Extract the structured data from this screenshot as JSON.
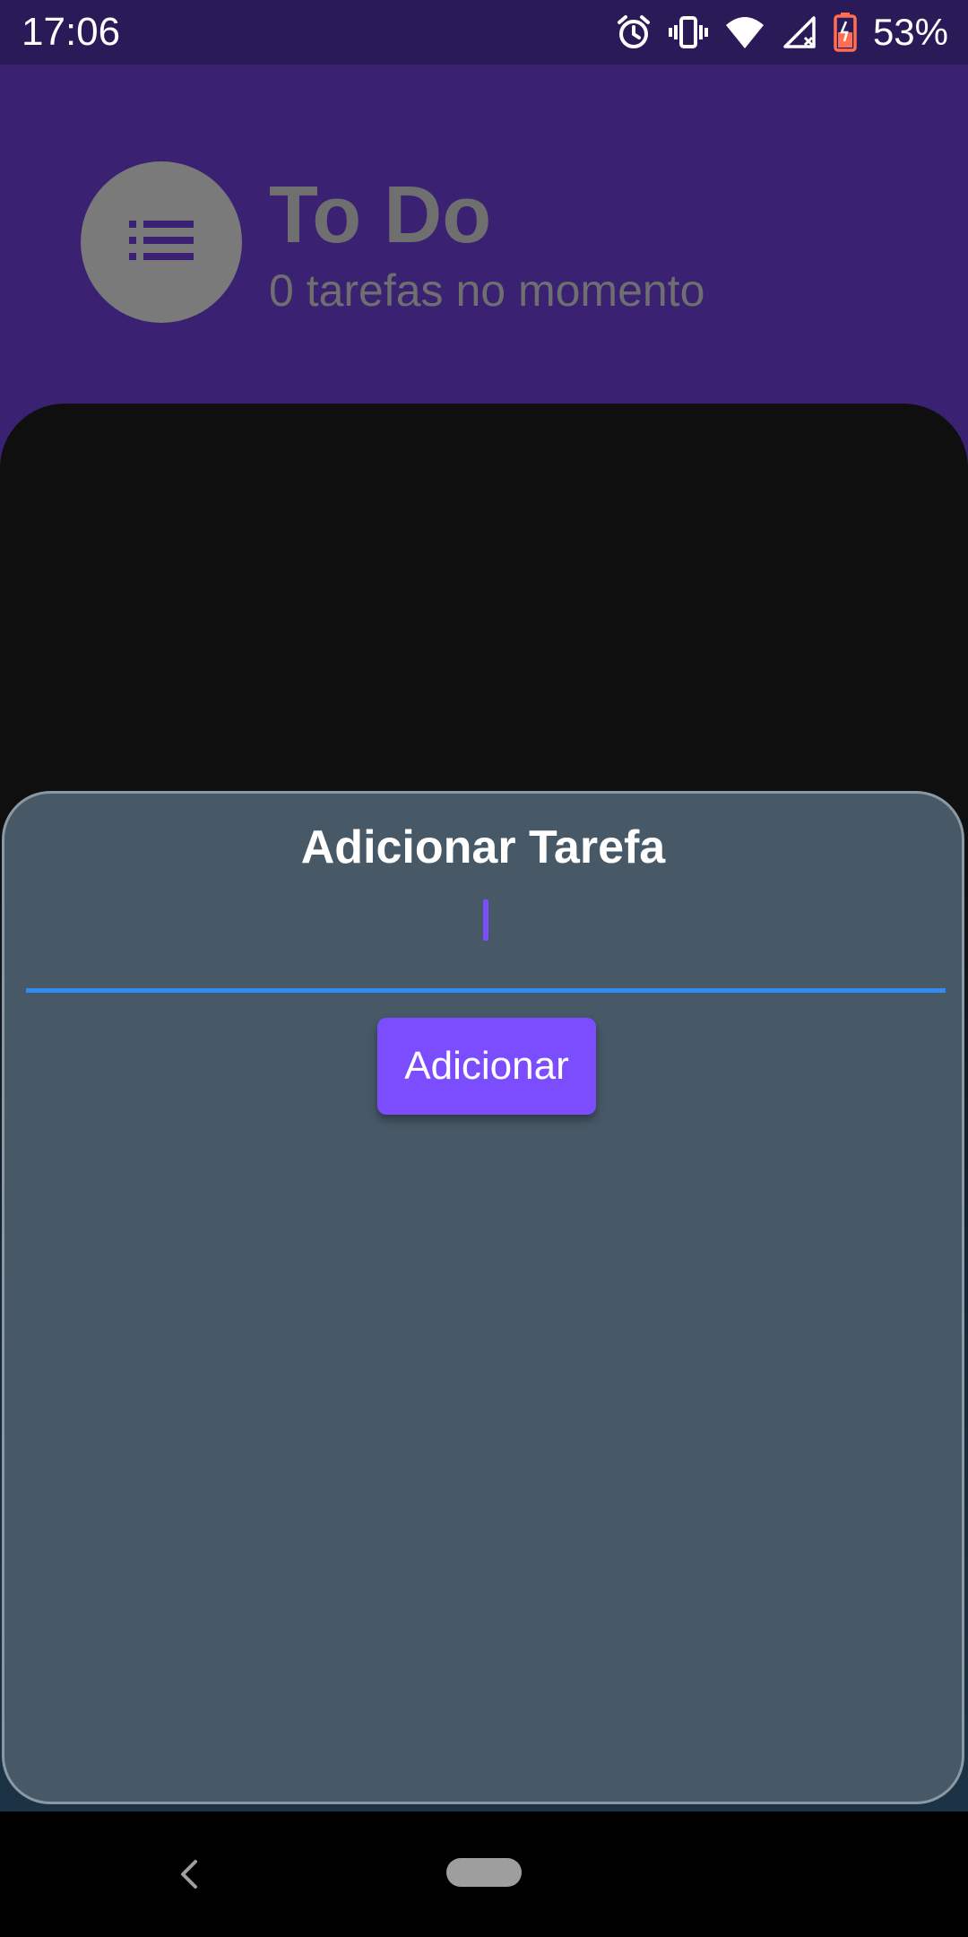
{
  "status_bar": {
    "time": "17:06",
    "battery": "53%",
    "icons": [
      "alarm-icon",
      "vibrate-icon",
      "wifi-icon",
      "signal-icon",
      "battery-icon"
    ]
  },
  "header": {
    "icon": "list-icon",
    "title": "To Do",
    "subtitle": "0 tarefas no momento"
  },
  "sheet": {
    "title": "Adicionar Tarefa",
    "input_value": "",
    "button_label": "Adicionar"
  },
  "nav_bar": {
    "icons": [
      "back-icon",
      "home-pill"
    ]
  },
  "colors": {
    "header_bg": "#3a2172",
    "status_bg": "#2a1a58",
    "accent": "#7c4dff",
    "underline": "#2f8cf0",
    "sheet_bg": "#475967"
  }
}
